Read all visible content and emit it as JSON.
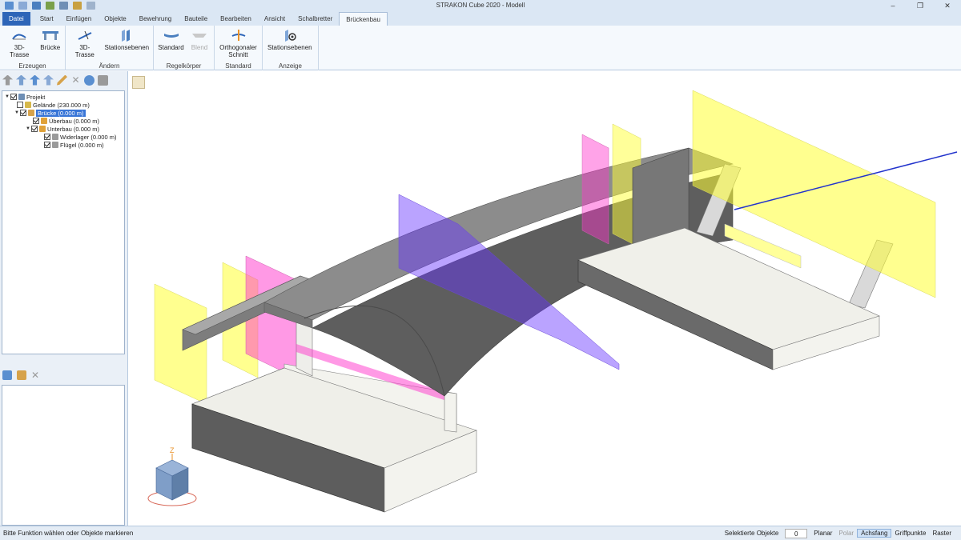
{
  "titlebar": {
    "title": "STRAKON Cube 2020 - Modell"
  },
  "tabs": [
    "Datei",
    "Start",
    "Einfügen",
    "Objekte",
    "Bewehrung",
    "Bauteile",
    "Bearbeiten",
    "Ansicht",
    "Schalbretter",
    "Brückenbau"
  ],
  "active_tab": "Brückenbau",
  "ribbon": {
    "groups": [
      {
        "label": "Erzeugen",
        "buttons": [
          {
            "label": "3D-Trasse",
            "icon": "road-alignment-icon"
          },
          {
            "label": "Brücke",
            "icon": "bridge-icon"
          }
        ]
      },
      {
        "label": "Ändern",
        "buttons": [
          {
            "label": "3D-Trasse",
            "icon": "edit-alignment-icon"
          },
          {
            "label": "Stationsebenen",
            "icon": "station-planes-icon"
          }
        ]
      },
      {
        "label": "Regelkörper",
        "buttons": [
          {
            "label": "Standard",
            "icon": "standard-body-icon"
          },
          {
            "label": "Blend",
            "icon": "blend-icon",
            "disabled": true
          }
        ]
      },
      {
        "label": "Standard",
        "buttons": [
          {
            "label": "Orthogonaler Schnitt",
            "icon": "orthogonal-section-icon"
          }
        ]
      },
      {
        "label": "Anzeige",
        "buttons": [
          {
            "label": "Stationsebenen",
            "icon": "station-planes-view-icon"
          }
        ]
      }
    ]
  },
  "tree": {
    "items": [
      {
        "label": "Projekt",
        "level": 0,
        "toggle": "expanded",
        "checked": true
      },
      {
        "label": "Gelände (230.000 m)",
        "level": 1,
        "toggle": "none",
        "checked": false
      },
      {
        "label": "Brücke (0.000 m)",
        "level": 1,
        "toggle": "expanded",
        "checked": true,
        "selected": true
      },
      {
        "label": "Überbau (0.000 m)",
        "level": 2,
        "toggle": "none",
        "checked": true
      },
      {
        "label": "Unterbau (0.000 m)",
        "level": 2,
        "toggle": "expanded",
        "checked": true
      },
      {
        "label": "Widerlager (0.000 m)",
        "level": 3,
        "toggle": "none",
        "checked": true
      },
      {
        "label": "Flügel (0.000 m)",
        "level": 3,
        "toggle": "none",
        "checked": true
      }
    ]
  },
  "status": {
    "message": "Bitte Funktion wählen oder Objekte markieren",
    "selected_label": "Selektierte Objekte",
    "selected_count": "0",
    "toggles": [
      {
        "label": "Planar",
        "state": "normal"
      },
      {
        "label": "Polar",
        "state": "disabled"
      },
      {
        "label": "Achsfang",
        "state": "active"
      },
      {
        "label": "Griffpunkte",
        "state": "normal"
      },
      {
        "label": "Raster",
        "state": "normal"
      }
    ]
  },
  "colors": {
    "accent": "#2d65b8",
    "yellow_plane": "#ffff33",
    "magenta_plane": "#ff33cc",
    "violet_plane": "#6633ff",
    "concrete_dark": "#5e5e5e",
    "concrete_mid": "#8c8c8c"
  },
  "view_cube": {
    "axis_z": "Z"
  }
}
